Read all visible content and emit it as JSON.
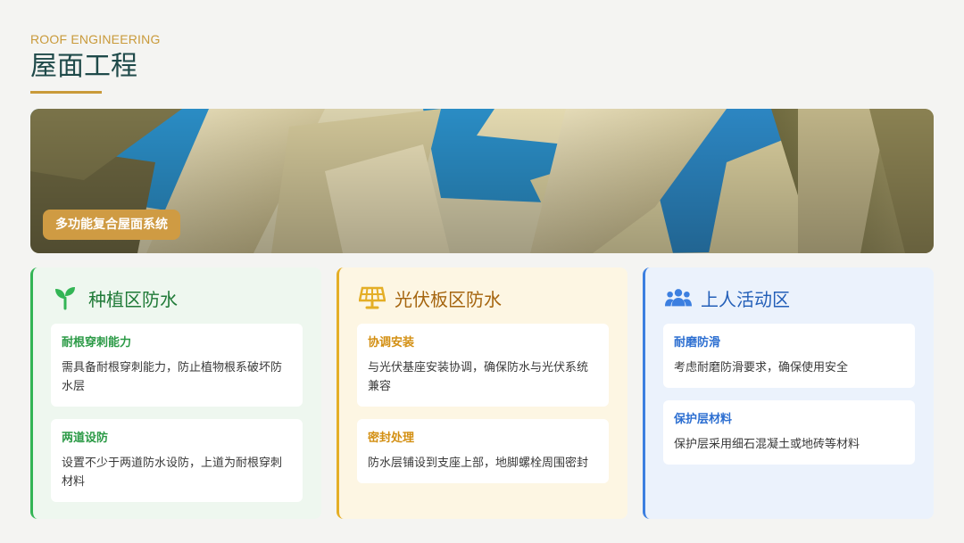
{
  "header": {
    "eyebrow": "ROOF ENGINEERING",
    "title": "屋面工程"
  },
  "hero": {
    "badge": "多功能复合屋面系统"
  },
  "colors": {
    "accent": "#c99a3a",
    "green": "#33b555",
    "amber": "#e4ae26",
    "blue": "#3c7fe0"
  },
  "cards": [
    {
      "title": "种植区防水",
      "icon": "seedling-icon",
      "items": [
        {
          "title": "耐根穿刺能力",
          "text": "需具备耐根穿刺能力，防止植物根系破坏防水层"
        },
        {
          "title": "两道设防",
          "text": "设置不少于两道防水设防，上道为耐根穿刺材料"
        }
      ]
    },
    {
      "title": "光伏板区防水",
      "icon": "solar-panel-icon",
      "items": [
        {
          "title": "协调安装",
          "text": "与光伏基座安装协调，确保防水与光伏系统兼容"
        },
        {
          "title": "密封处理",
          "text": "防水层铺设到支座上部，地脚螺栓周围密封"
        }
      ]
    },
    {
      "title": "上人活动区",
      "icon": "people-group-icon",
      "items": [
        {
          "title": "耐磨防滑",
          "text": "考虑耐磨防滑要求，确保使用安全"
        },
        {
          "title": "保护层材料",
          "text": "保护层采用细石混凝土或地砖等材料"
        }
      ]
    }
  ]
}
